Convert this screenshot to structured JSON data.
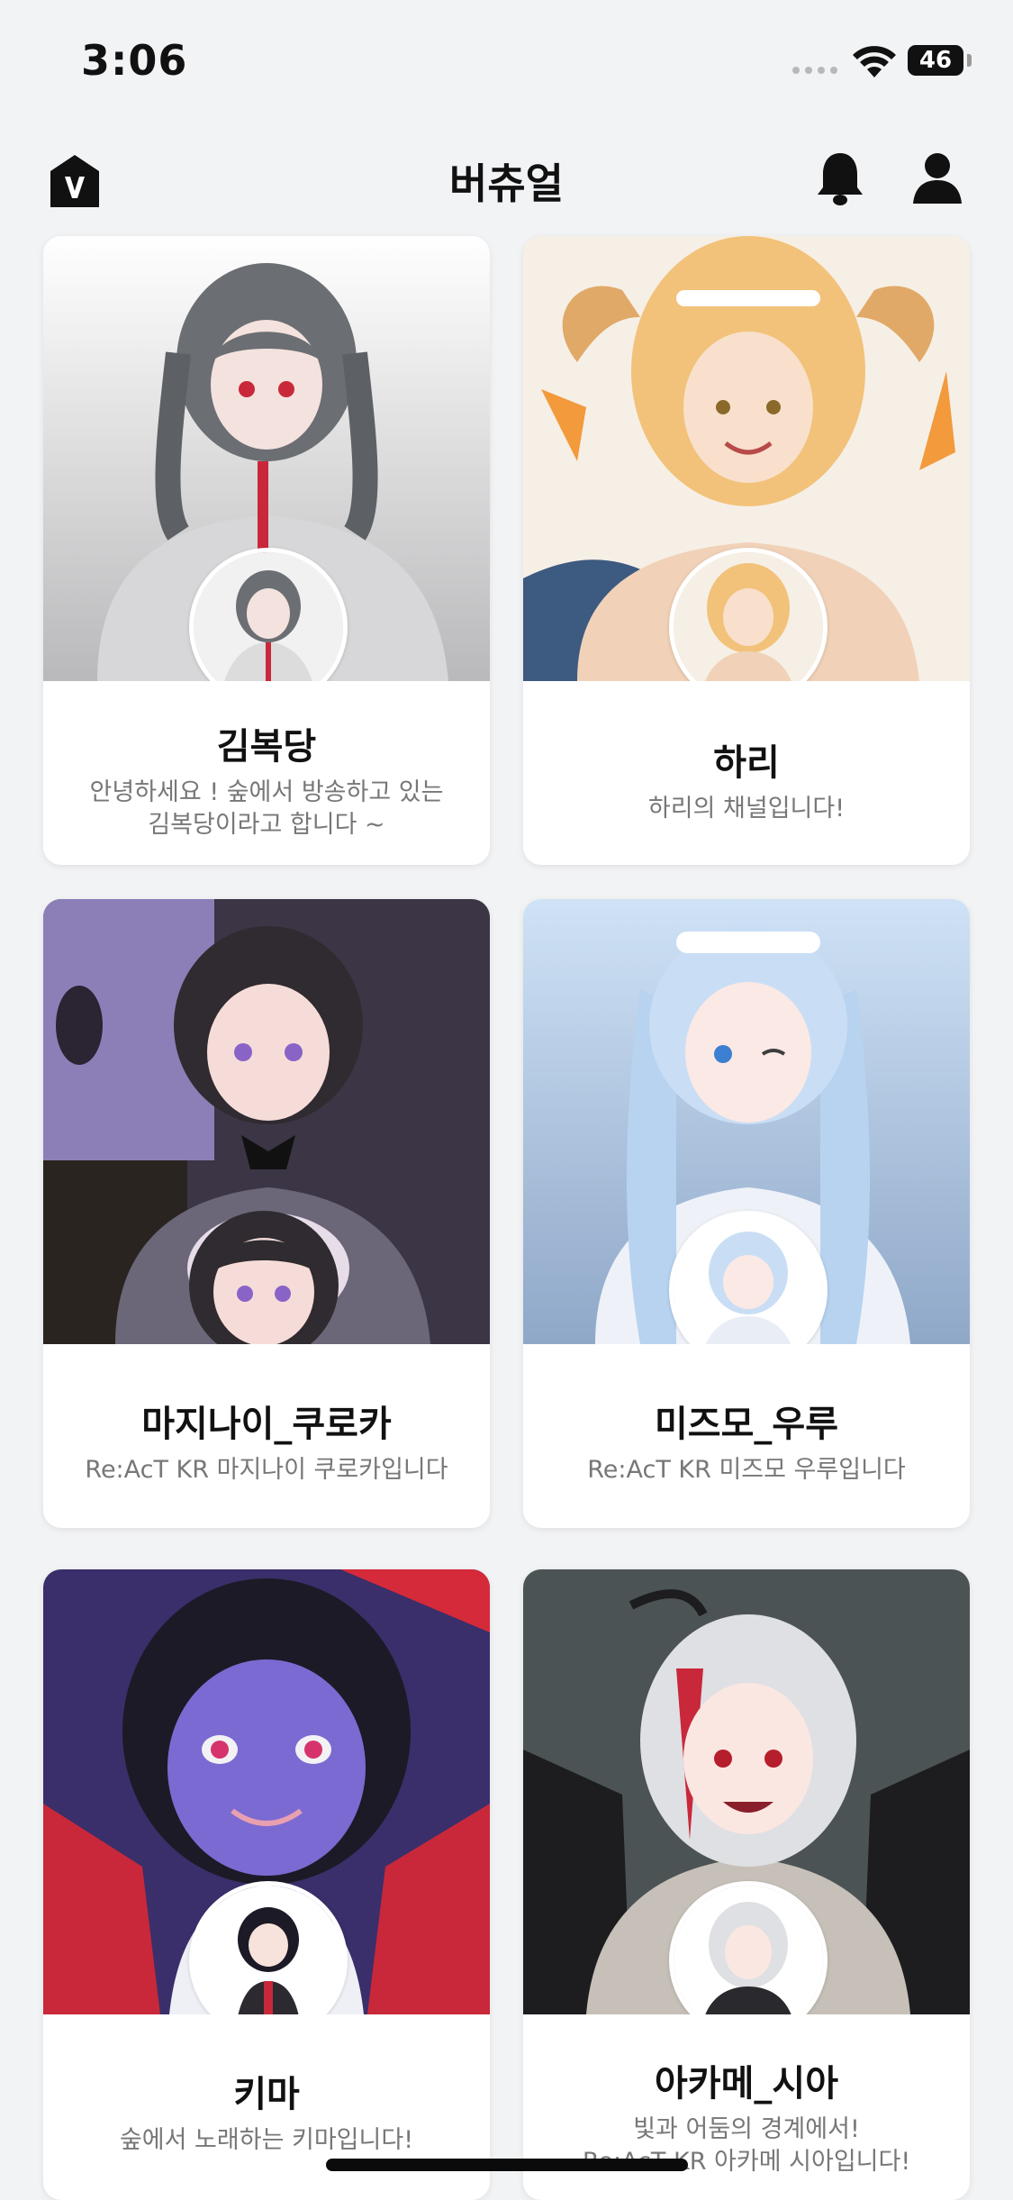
{
  "status_bar": {
    "time": "3:06",
    "battery": "46"
  },
  "header": {
    "title": "버츄얼",
    "logo_letter": "V"
  },
  "cards": [
    {
      "name": "김복당",
      "description": "안녕하세요 ! 숲에서 방송하고 있는\n김복당이라고 합니다 ~"
    },
    {
      "name": "하리",
      "description": "하리의 채널입니다!"
    },
    {
      "name": "마지나이_쿠로카",
      "description": "Re:AcT KR 마지나이 쿠로카입니다"
    },
    {
      "name": "미즈모_우루",
      "description": "Re:AcT KR 미즈모 우루입니다"
    },
    {
      "name": "키마",
      "description": "숲에서 노래하는 키마입니다!"
    },
    {
      "name": "아카메_시아",
      "description": "빛과 어둠의 경계에서!\nRe:AcT KR 아카메 시아입니다!"
    }
  ],
  "colors": {
    "background": "#f2f3f5",
    "card": "#ffffff",
    "text": "#111111",
    "subtext": "#777777"
  }
}
